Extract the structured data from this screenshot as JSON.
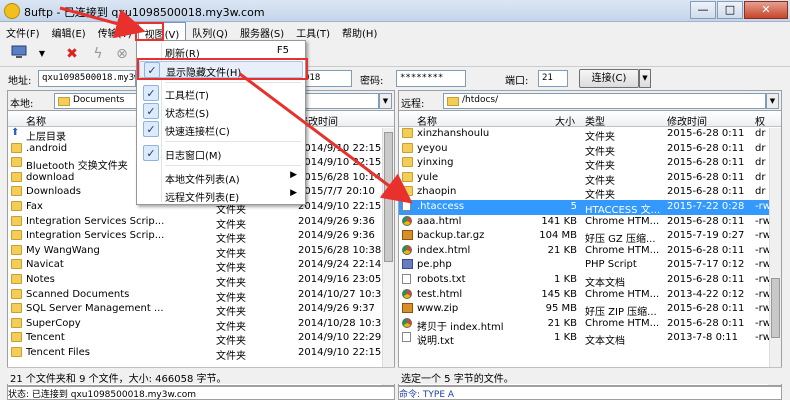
{
  "window": {
    "title": "8uftp - 已连接到 qxu1098500018.my3w.com",
    "controls": {
      "minimize": "—",
      "maximize": "□",
      "close": "✕"
    }
  },
  "menubar": [
    "文件(F)",
    "编辑(E)",
    "传输(T)",
    "视图(V)",
    "队列(Q)",
    "服务器(S)",
    "工具(T)",
    "帮助(H)"
  ],
  "toolbar": {
    "icons": [
      "monitor-icon",
      "delete-icon",
      "flash-icon",
      "stop-icon"
    ]
  },
  "address": {
    "host_label": "地址:",
    "host_value": "qxu1098500018.my3w.co",
    "user_value": "018",
    "password_label": "密码:",
    "password_value": "********",
    "port_label": "端口:",
    "port_value": "21",
    "connect_label": "连接(C)"
  },
  "view_menu": {
    "items": [
      {
        "label": "刷新(R)",
        "key": "F5",
        "checked": false
      },
      {
        "label": "显示隐藏文件(H)",
        "checked": true
      },
      {
        "label": "工具栏(T)",
        "checked": true
      },
      {
        "label": "状态栏(S)",
        "checked": true
      },
      {
        "label": "快速连接栏(C)",
        "checked": true
      },
      {
        "label": "日志窗口(M)",
        "checked": true
      },
      {
        "label": "本地文件列表(A)",
        "submenu": true
      },
      {
        "label": "远程文件列表(E)",
        "submenu": true
      }
    ]
  },
  "local": {
    "label": "本地:",
    "path": "Documents",
    "columns": [
      "名称",
      "类型",
      "修改时间"
    ],
    "rows": [
      {
        "name": "上层目录",
        "type": "",
        "date": "",
        "icon": "up"
      },
      {
        "name": ".android",
        "type": "",
        "date": "2014/9/10 22:15",
        "icon": "folder"
      },
      {
        "name": "Bluetooth 交换文件夹",
        "type": "",
        "date": "2014/9/10 22:15",
        "icon": "folder"
      },
      {
        "name": "download",
        "type": "",
        "date": "2015/6/28 10:14",
        "icon": "folder"
      },
      {
        "name": "Downloads",
        "type": "",
        "date": "2015/7/7 20:10",
        "icon": "folder"
      },
      {
        "name": "Fax",
        "type": "文件夹",
        "date": "2014/9/10 22:15",
        "icon": "folder"
      },
      {
        "name": "Integration Services Scrip...",
        "type": "文件夹",
        "date": "2014/9/26 9:36",
        "icon": "folder"
      },
      {
        "name": "Integration Services Scrip...",
        "type": "文件夹",
        "date": "2014/9/26 9:36",
        "icon": "folder"
      },
      {
        "name": "My WangWang",
        "type": "文件夹",
        "date": "2015/6/28 10:38",
        "icon": "folder"
      },
      {
        "name": "Navicat",
        "type": "文件夹",
        "date": "2014/9/24 22:14",
        "icon": "folder"
      },
      {
        "name": "Notes",
        "type": "文件夹",
        "date": "2014/9/16 23:05",
        "icon": "folder"
      },
      {
        "name": "Scanned Documents",
        "type": "文件夹",
        "date": "2014/10/27 10:36",
        "icon": "folder"
      },
      {
        "name": "SQL Server Management ...",
        "type": "文件夹",
        "date": "2014/9/26 9:37",
        "icon": "folder"
      },
      {
        "name": "SuperCopy",
        "type": "文件夹",
        "date": "2014/10/28 10:35",
        "icon": "folder"
      },
      {
        "name": "Tencent",
        "type": "文件夹",
        "date": "2014/9/10 22:29",
        "icon": "folder"
      },
      {
        "name": "Tencent Files",
        "type": "文件夹",
        "date": "2014/9/10 22:15",
        "icon": "folder"
      }
    ],
    "status": "21 个文件夹和 9 个文件，大小: 466058 字节。"
  },
  "remote": {
    "label": "远程:",
    "path": "/htdocs/",
    "columns": [
      "名称",
      "大小",
      "类型",
      "修改时间",
      "权"
    ],
    "rows": [
      {
        "name": "xinzhanshoulu",
        "size": "",
        "type": "文件夹",
        "date": "2015-6-28 0:11",
        "perm": "dr",
        "icon": "folder"
      },
      {
        "name": "yeyou",
        "size": "",
        "type": "文件夹",
        "date": "2015-6-28 0:11",
        "perm": "dr",
        "icon": "folder"
      },
      {
        "name": "yinxing",
        "size": "",
        "type": "文件夹",
        "date": "2015-6-28 0:11",
        "perm": "dr",
        "icon": "folder"
      },
      {
        "name": "yule",
        "size": "",
        "type": "文件夹",
        "date": "2015-6-28 0:11",
        "perm": "dr",
        "icon": "folder"
      },
      {
        "name": "zhaopin",
        "size": "",
        "type": "文件夹",
        "date": "2015-6-28 0:11",
        "perm": "dr",
        "icon": "folder"
      },
      {
        "name": ".htaccess",
        "size": "5",
        "type": "HTACCESS 文...",
        "date": "2015-7-22 0:28",
        "perm": "-rw",
        "icon": "file",
        "selected": true
      },
      {
        "name": "aaa.html",
        "size": "141 KB",
        "type": "Chrome HTM...",
        "date": "2015-6-28 0:11",
        "perm": "-rw",
        "icon": "chrome"
      },
      {
        "name": "backup.tar.gz",
        "size": "104 MB",
        "type": "好压 GZ 压缩...",
        "date": "2015-7-19 0:27",
        "perm": "-rw",
        "icon": "zip"
      },
      {
        "name": "index.html",
        "size": "21 KB",
        "type": "Chrome HTM...",
        "date": "2015-6-28 0:11",
        "perm": "-rw",
        "icon": "chrome"
      },
      {
        "name": "pe.php",
        "size": "",
        "type": "PHP Script",
        "date": "2015-7-17 0:12",
        "perm": "-rw",
        "icon": "php"
      },
      {
        "name": "robots.txt",
        "size": "1 KB",
        "type": "文本文档",
        "date": "2015-6-28 0:11",
        "perm": "-rw",
        "icon": "file"
      },
      {
        "name": "test.html",
        "size": "145 KB",
        "type": "Chrome HTM...",
        "date": "2013-4-22 0:12",
        "perm": "-rw",
        "icon": "chrome"
      },
      {
        "name": "www.zip",
        "size": "95 MB",
        "type": "好压 ZIP 压缩...",
        "date": "2015-6-28 0:11",
        "perm": "-rw",
        "icon": "zip"
      },
      {
        "name": "拷贝于 index.html",
        "size": "21 KB",
        "type": "Chrome HTM...",
        "date": "2015-6-28 0:11",
        "perm": "-rw",
        "icon": "chrome"
      },
      {
        "name": "说明.txt",
        "size": "1 KB",
        "type": "文本文档",
        "date": "2013-7-8 0:11",
        "perm": "-rw",
        "icon": "file"
      }
    ],
    "status": "选定一个 5 字节的文件。"
  },
  "log": {
    "left": "状态:  已连接到 qxu1098500018.my3w.com",
    "right": "命令:  TYPE A"
  },
  "colors": {
    "annotation_red": "#e8302c",
    "selection_blue": "#3399ff"
  }
}
